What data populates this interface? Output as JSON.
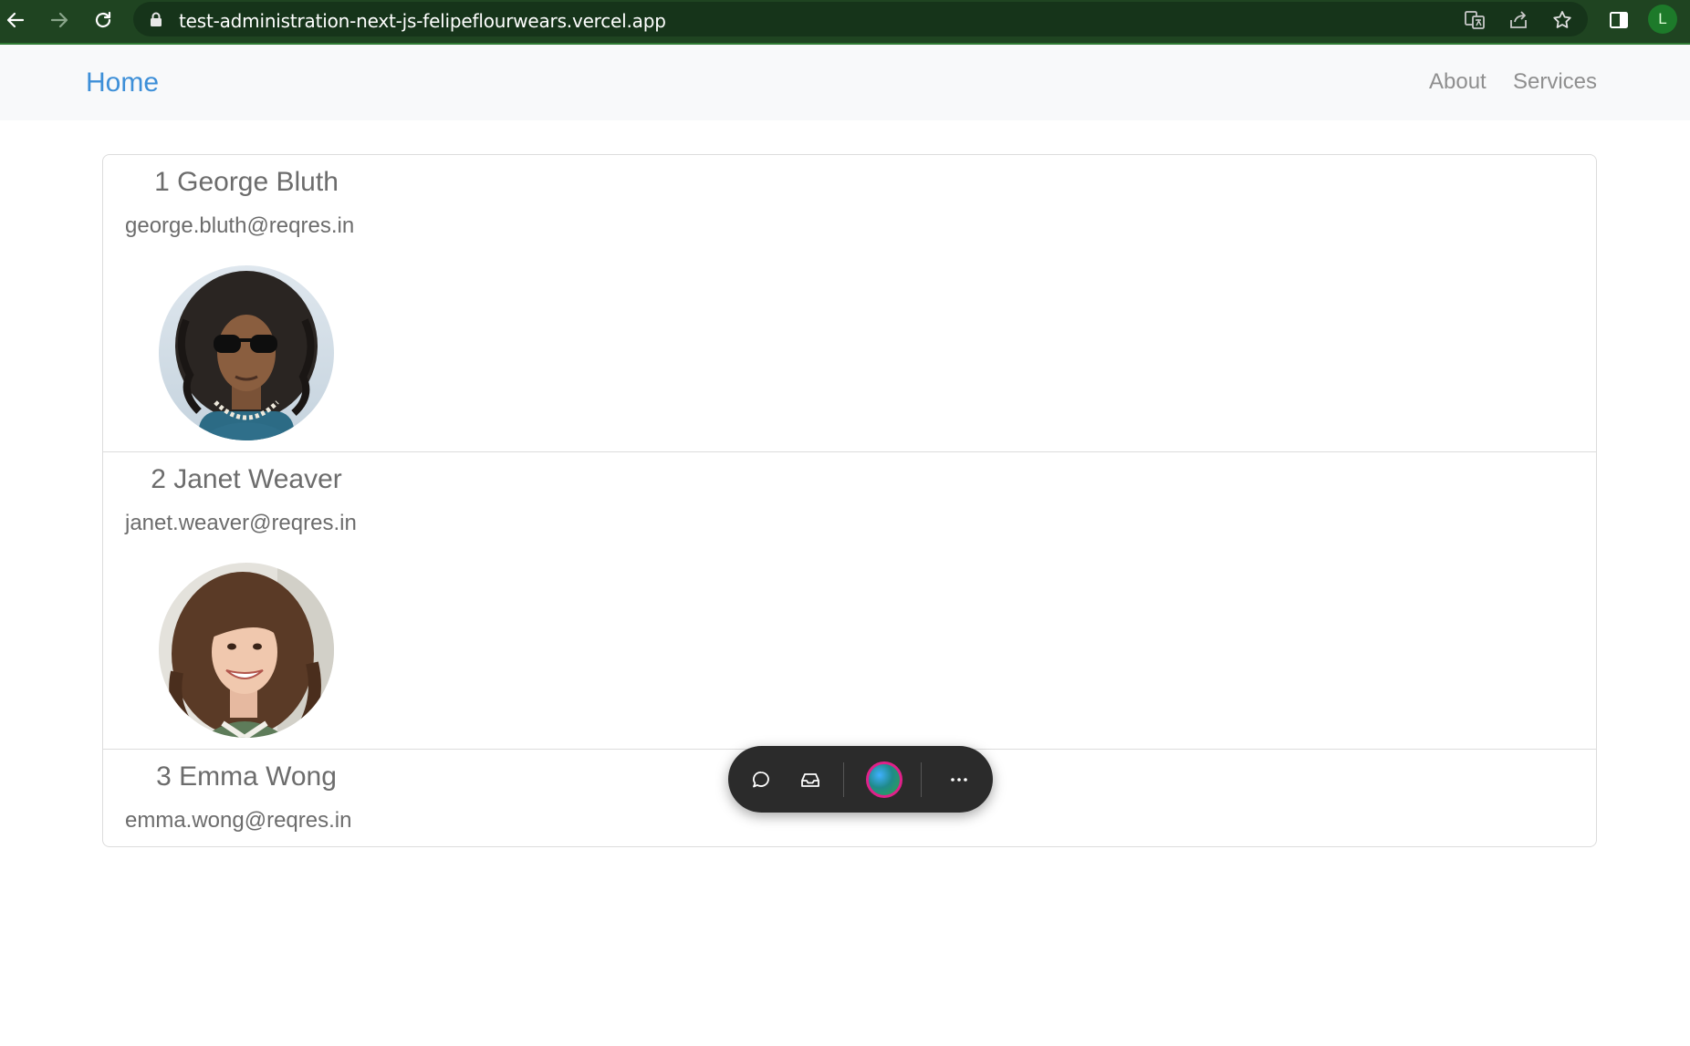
{
  "browser": {
    "url": "test-administration-next-js-felipeflourwears.vercel.app",
    "profile_initial": "L",
    "icons": [
      "back-arrow-icon",
      "forward-arrow-icon",
      "reload-icon",
      "lock-icon",
      "translate-icon",
      "share-icon",
      "star-icon",
      "side-panel-icon"
    ],
    "colors": {
      "frame": "#1f4421",
      "omnibox": "#16341a",
      "profile": "#1d7a2a"
    }
  },
  "navbar": {
    "brand": "Home",
    "links": [
      "About",
      "Services"
    ],
    "colors": {
      "brand": "#3d8fd8",
      "link": "#8f8f8f",
      "background": "#f8f9fa"
    }
  },
  "users": [
    {
      "title": "1 George Bluth",
      "email": "george.bluth@reqres.in"
    },
    {
      "title": "2 Janet Weaver",
      "email": "janet.weaver@reqres.in"
    },
    {
      "title": "3 Emma Wong",
      "email": "emma.wong@reqres.in"
    }
  ],
  "toolbar": {
    "icons": [
      "comment-icon",
      "inbox-icon",
      "avatar-orb",
      "more-options-icon"
    ],
    "colors": {
      "background": "#2b2b2b",
      "orb_ring": "#e0218a"
    }
  }
}
